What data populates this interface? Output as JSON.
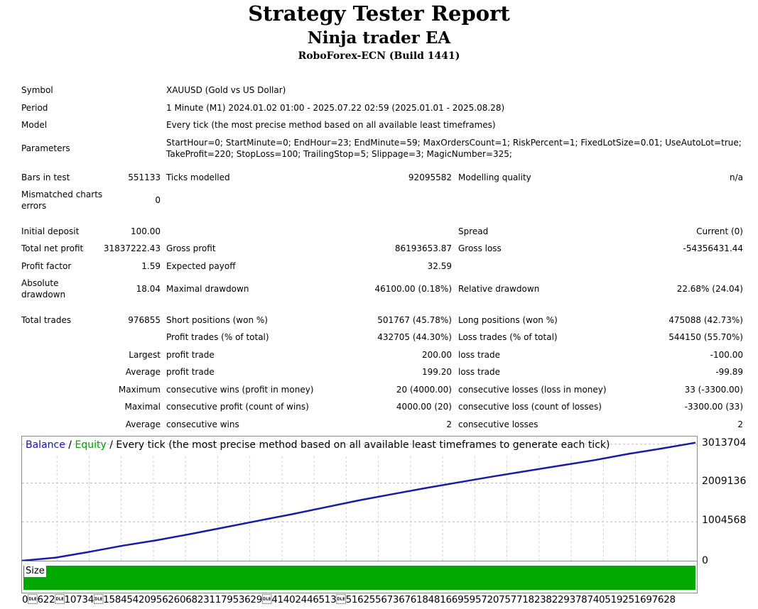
{
  "header": {
    "title": "Strategy Tester Report",
    "subtitle": "Ninja trader EA",
    "broker": "RoboForex-ECN (Build 1441)"
  },
  "settings": {
    "symbol_label": "Symbol",
    "symbol_value": "XAUUSD (Gold vs US Dollar)",
    "period_label": "Period",
    "period_value": "1 Minute (M1) 2024.01.02 01:00 - 2025.07.22 02:59 (2025.01.01 - 2025.08.28)",
    "model_label": "Model",
    "model_value": "Every tick (the most precise method based on all available least timeframes)",
    "parameters_label": "Parameters",
    "parameters_line1": "StartHour=0; StartMinute=0; EndHour=23; EndMinute=59; MaxOrdersCount=1; RiskPercent=1; FixedLotSize=0.01; UseAutoLot=true;",
    "parameters_line2": "TakeProfit=220; StopLoss=100; TrailingStop=5; Slippage=3; MagicNumber=325;"
  },
  "stats": {
    "bars_label": "Bars in test",
    "bars_value": "551133",
    "ticks_label": "Ticks modelled",
    "ticks_value": "92095582",
    "quality_label": "Modelling quality",
    "quality_value": "n/a",
    "mismatch_label1": "Mismatched charts",
    "mismatch_label2": "errors",
    "mismatch_value": "0",
    "deposit_label": "Initial deposit",
    "deposit_value": "100.00",
    "spread_label": "Spread",
    "spread_value": "Current (0)",
    "netprofit_label": "Total net profit",
    "netprofit_value": "31837222.43",
    "grossprofit_label": "Gross profit",
    "grossprofit_value": "86193653.87",
    "grossloss_label": "Gross loss",
    "grossloss_value": "-54356431.44",
    "pf_label": "Profit factor",
    "pf_value": "1.59",
    "payoff_label": "Expected payoff",
    "payoff_value": "32.59",
    "absdd_label1": "Absolute",
    "absdd_label2": "drawdown",
    "absdd_value": "18.04",
    "maxdd_label": "Maximal drawdown",
    "maxdd_value": "46100.00 (0.18%)",
    "reldd_label": "Relative drawdown",
    "reldd_value": "22.68% (24.04)",
    "trades_label": "Total trades",
    "trades_value": "976855",
    "short_label": "Short positions (won %)",
    "short_value": "501767 (45.78%)",
    "long_label": "Long positions (won %)",
    "long_value": "475088 (42.73%)",
    "ptrades_label": "Profit trades (% of total)",
    "ptrades_value": "432705 (44.30%)",
    "ltrades_label": "Loss trades (% of total)",
    "ltrades_value": "544150 (55.70%)",
    "largest_label": "Largest",
    "largest_profit_label": "profit trade",
    "largest_profit_value": "200.00",
    "largest_loss_label": "loss trade",
    "largest_loss_value": "-100.00",
    "average_label": "Average",
    "average_profit_label": "profit trade",
    "average_profit_value": "199.20",
    "average_loss_label": "loss trade",
    "average_loss_value": "-99.89",
    "maximum_label": "Maximum",
    "max_wins_label": "consecutive wins (profit in money)",
    "max_wins_value": "20 (4000.00)",
    "max_losses_label": "consecutive losses (loss in money)",
    "max_losses_value": "33 (-3300.00)",
    "maximal_label": "Maximal",
    "maximal_profit_label": "consecutive profit (count of wins)",
    "maximal_profit_value": "4000.00 (20)",
    "maximal_loss_label": "consecutive loss (count of losses)",
    "maximal_loss_value": "-3300.00 (33)",
    "avgcons_label": "Average",
    "avgcons_wins_label": "consecutive wins",
    "avgcons_wins_value": "2",
    "avgcons_losses_label": "consecutive losses",
    "avgcons_losses_value": "2"
  },
  "chart": {
    "legend_balance": "Balance",
    "legend_sep1": " / ",
    "legend_equity": "Equity",
    "legend_rest": " / Every tick (the most precise method based on all available least timeframes to generate each tick)",
    "size_label": "Size",
    "x_axis_text": "0\u0010622\u001010734\u0010158454209562606823117953629\u001041402446513\u001051625567367618481669595720757718238229378740519251697628",
    "colors": {
      "balance": "#1a1aa8",
      "equity": "#00a000",
      "size_bar": "#00a800"
    }
  },
  "chart_data": {
    "type": "line",
    "title": "",
    "xlabel": "",
    "ylabel": "",
    "y_ticks": [
      "3013704",
      "2009136",
      "1004568",
      "0"
    ],
    "ylim": [
      0,
      3210000
    ],
    "x": [
      0,
      0.05,
      0.1,
      0.15,
      0.2,
      0.25,
      0.3,
      0.35,
      0.4,
      0.45,
      0.5,
      0.55,
      0.6,
      0.65,
      0.7,
      0.75,
      0.8,
      0.85,
      0.9,
      0.95,
      1.0
    ],
    "series": [
      {
        "name": "Balance",
        "values": [
          0,
          80000,
          230000,
          390000,
          530000,
          690000,
          860000,
          1030000,
          1200000,
          1380000,
          1560000,
          1720000,
          1880000,
          2030000,
          2180000,
          2320000,
          2460000,
          2600000,
          2760000,
          2900000,
          3050000
        ]
      }
    ],
    "grid": true
  }
}
